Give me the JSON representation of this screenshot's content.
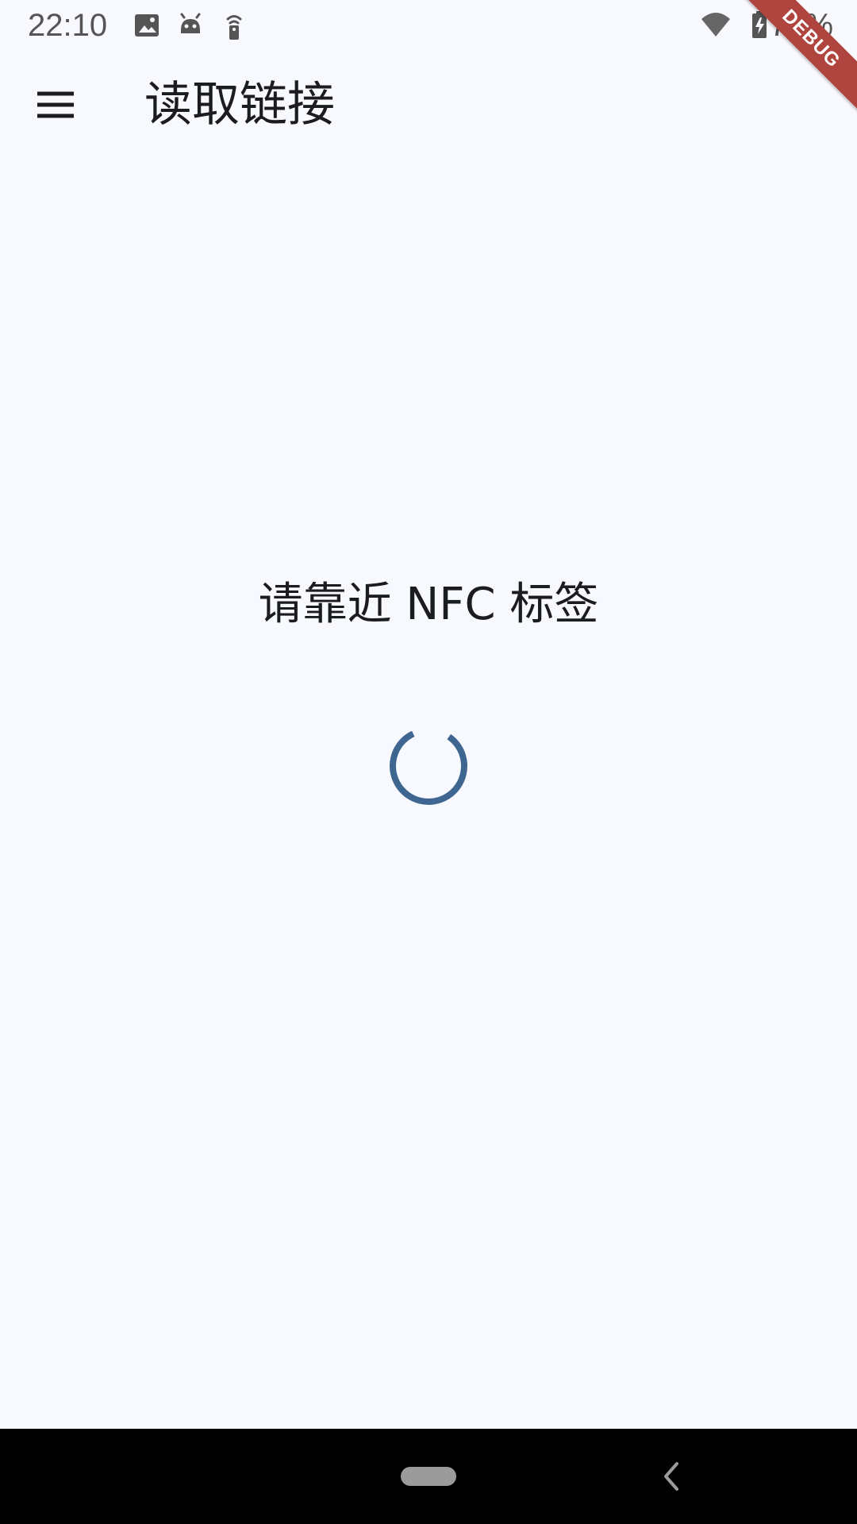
{
  "status_bar": {
    "time": "22:10",
    "battery": "78%",
    "icons": [
      "image-icon",
      "android-icon",
      "remote-icon",
      "wifi-icon",
      "battery-charging-icon"
    ]
  },
  "debug_banner": {
    "label": "DEBUG"
  },
  "app_bar": {
    "title": "读取链接",
    "menu_icon": "menu-icon"
  },
  "main": {
    "message": "请靠近 NFC 标签",
    "loading_indicator": "progress-spinner",
    "spinner_color": "#3f6690"
  },
  "navigation_bar": {
    "home_icon": "home-pill-icon",
    "back_icon": "back-arrow-icon"
  },
  "colors": {
    "background": "#f8f9ff",
    "text": "#1b1c1f",
    "debug_banner": "#b0443f",
    "nav_bar": "#000000"
  }
}
